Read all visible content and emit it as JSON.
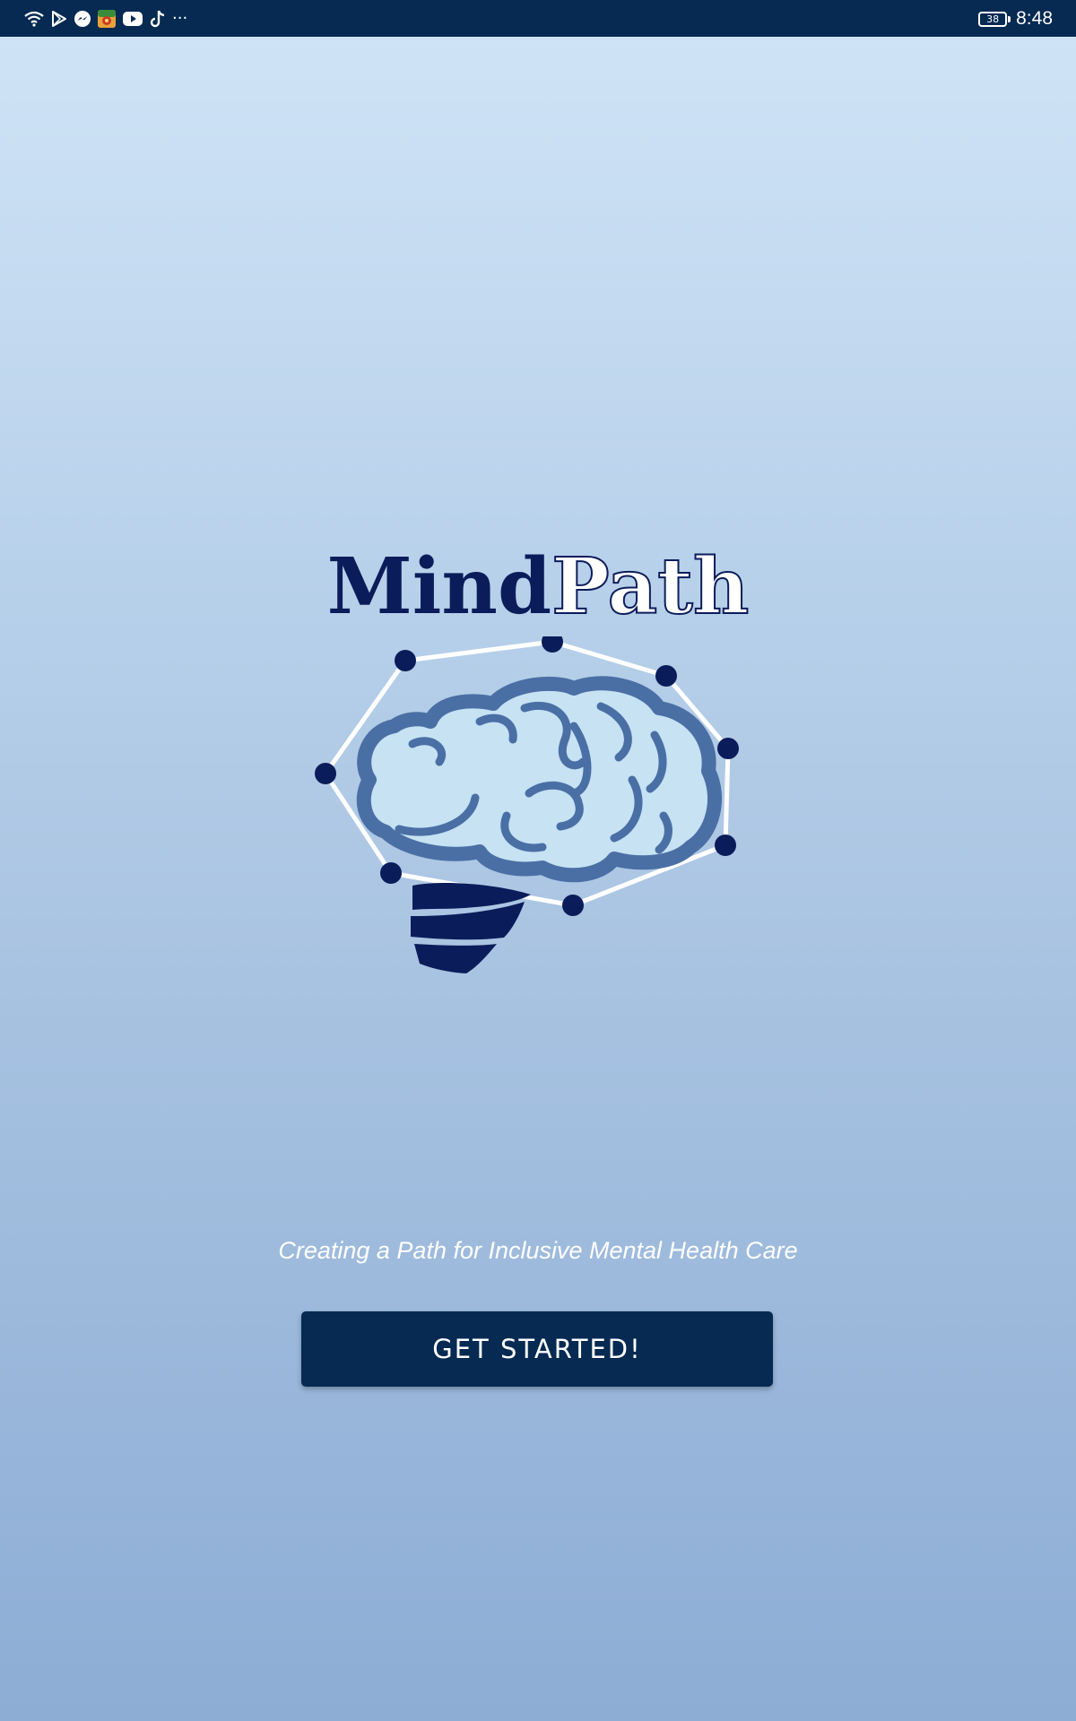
{
  "status_bar": {
    "time": "8:48",
    "battery_level": "38",
    "icons": [
      "wifi-icon",
      "play-store-icon",
      "messenger-icon",
      "app-icon",
      "youtube-icon",
      "tiktok-icon",
      "more-icon"
    ],
    "more_label": "···"
  },
  "logo": {
    "title_part1": "Mind",
    "title_part2": "Path"
  },
  "tagline": "Creating a Path for Inclusive Mental Health Care",
  "cta": {
    "label": "GET STARTED!"
  },
  "colors": {
    "status_bar_bg": "#062a52",
    "button_bg": "#062a52",
    "brand_navy": "#0b1c5a",
    "brain_fill": "#c6e2f3",
    "brain_stroke": "#4a6fa5",
    "background_top": "#d0e4f6",
    "background_bottom": "#8dadd5"
  }
}
